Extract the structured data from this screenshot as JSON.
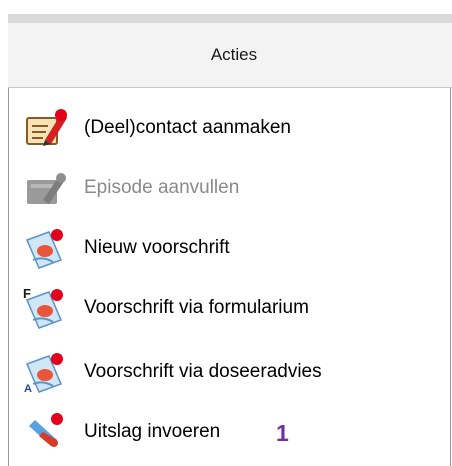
{
  "header": {
    "title": "Acties"
  },
  "actions": [
    {
      "label": "(Deel)contact aanmaken",
      "icon": "contact-pencil-icon",
      "enabled": true
    },
    {
      "label": "Episode aanvullen",
      "icon": "episode-pencil-icon",
      "enabled": false
    },
    {
      "label": "Nieuw voorschrift",
      "icon": "prescription-icon",
      "enabled": true
    },
    {
      "label": "Voorschrift via formularium",
      "icon": "prescription-formulary-icon",
      "enabled": true
    },
    {
      "label": "Voorschrift via doseeradvies",
      "icon": "prescription-dosing-icon",
      "enabled": true
    },
    {
      "label": "Uitslag invoeren",
      "icon": "test-tube-icon",
      "enabled": true
    }
  ],
  "annotation": {
    "number": "1"
  },
  "colors": {
    "badge": "#7030a0",
    "status_dot": "#e3001b",
    "disabled_text": "#8a8a8a"
  }
}
